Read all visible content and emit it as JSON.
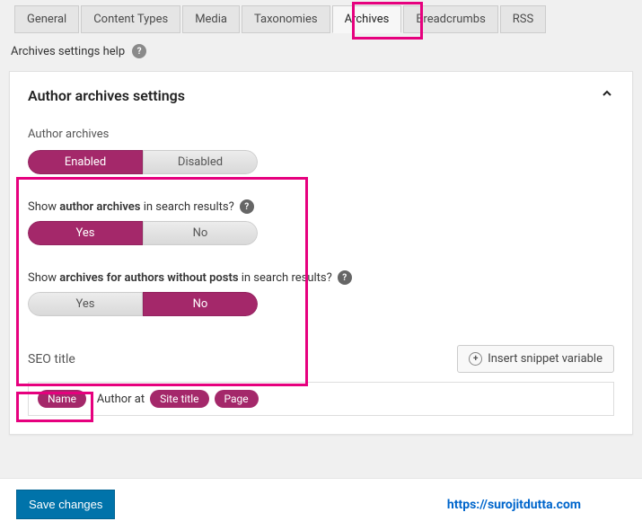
{
  "tabs": {
    "general": "General",
    "content_types": "Content Types",
    "media": "Media",
    "taxonomies": "Taxonomies",
    "archives": "Archives",
    "breadcrumbs": "Breadcrumbs",
    "rss": "RSS"
  },
  "help": {
    "label": "Archives settings help"
  },
  "panel": {
    "title": "Author archives settings"
  },
  "author_archives": {
    "label": "Author archives",
    "enabled": "Enabled",
    "disabled": "Disabled"
  },
  "q1": {
    "pre": "Show ",
    "bold": "author archives",
    "post": " in search results?",
    "yes": "Yes",
    "no": "No"
  },
  "q2": {
    "pre": "Show ",
    "bold": "archives for authors without posts",
    "post": " in search results?",
    "yes": "Yes",
    "no": "No"
  },
  "seo": {
    "title_label": "SEO title",
    "insert_btn": "Insert snippet variable",
    "pill_name": "Name",
    "sep": ", Author at ",
    "pill_site": "Site title",
    "pill_page": "Page"
  },
  "footer": {
    "save": "Save changes",
    "link": "https://surojitdutta.com"
  }
}
